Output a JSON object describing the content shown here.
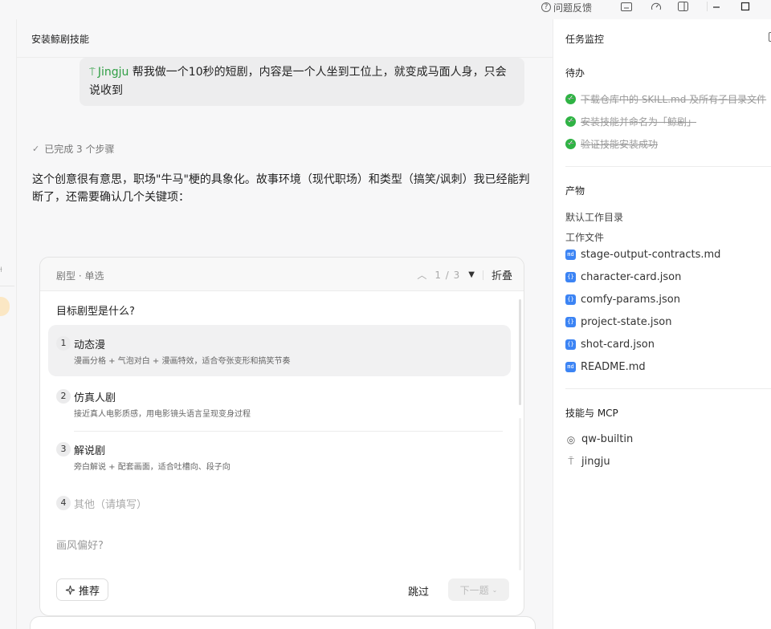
{
  "titlebar": {
    "feedback_label": "问题反馈"
  },
  "main": {
    "title": "安装鲸剧技能",
    "user_message": {
      "mention": "Jingju",
      "text": " 帮我做一个10秒的短剧，内容是一个人坐到工位上，就变成马面人身，只会说收到"
    },
    "steps_label": "已完成 3 个步骤",
    "reply_text": "这个创意很有意思，职场\"牛马\"梗的具象化。故事环境（现代职场）和类型（搞笑/讽刺）我已经能判断了，还需要确认几个关键项："
  },
  "card": {
    "head_label": "剧型 · 单选",
    "counter": "1 / 3",
    "fold_label": "折叠",
    "question": "目标剧型是什么?",
    "options": [
      {
        "num": "1",
        "title": "动态漫",
        "desc": "漫画分格 + 气泡对白 + 漫画特效，适合夸张变形和搞笑节奏"
      },
      {
        "num": "2",
        "title": "仿真人剧",
        "desc": "接近真人电影质感，用电影镜头语言呈现变身过程"
      },
      {
        "num": "3",
        "title": "解说剧",
        "desc": "旁白解说 + 配套画面，适合吐槽向、段子向"
      },
      {
        "num": "4",
        "title": "其他（请填写）",
        "desc": ""
      }
    ],
    "next_question": "画风偏好?",
    "recommend_label": "推荐",
    "skip_label": "跳过",
    "next_label": "下一题"
  },
  "panel": {
    "title": "任务监控",
    "todo_title": "待办",
    "todos": [
      "下载仓库中的 SKILL.md 及所有子目录文件",
      "安装技能并命名为「鲸剧」",
      "验证技能安装成功"
    ],
    "artifacts_title": "产物",
    "default_dir_label": "默认工作目录",
    "work_files_label": "工作文件",
    "files": [
      {
        "name": "stage-output-contracts.md",
        "icon": "md"
      },
      {
        "name": "character-card.json",
        "icon": "{}"
      },
      {
        "name": "comfy-params.json",
        "icon": "{}"
      },
      {
        "name": "project-state.json",
        "icon": "{}"
      },
      {
        "name": "shot-card.json",
        "icon": "{}"
      },
      {
        "name": "README.md",
        "icon": "md"
      }
    ],
    "skills_title": "技能与 MCP",
    "skills": [
      {
        "name": "qw-builtin",
        "icon": "fingerprint-icon"
      },
      {
        "name": "jingju",
        "icon": "tag-icon"
      }
    ]
  },
  "colors": {
    "mention_green": "#2f9e44",
    "done_green": "#2fb344",
    "file_blue": "#3c84f4"
  }
}
